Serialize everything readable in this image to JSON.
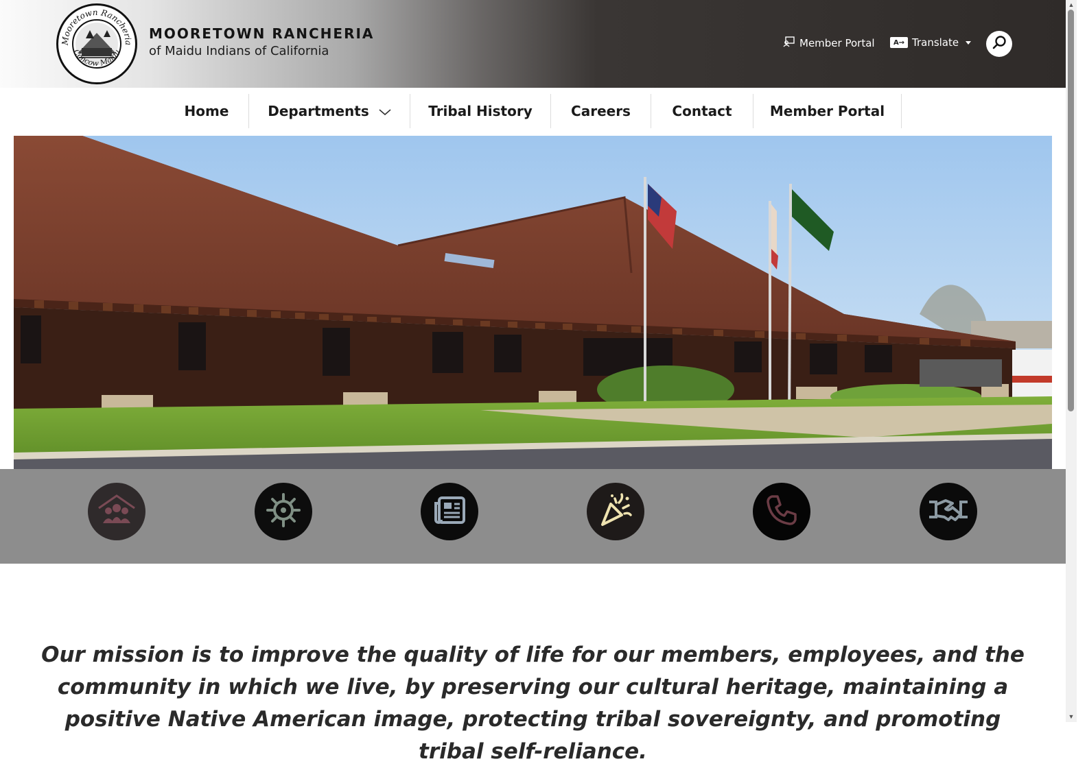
{
  "header": {
    "brand_name": "MOORETOWN RANCHERIA",
    "brand_subtitle": "of Maidu Indians of California",
    "logo_ring_top": "Mooretown Rancheria",
    "logo_ring_bottom": "Concow Maidu",
    "member_portal_label": "Member Portal",
    "translate_label": "Translate",
    "translate_icon_text": "A→",
    "colors": {
      "header_dark": "#2f2b29",
      "header_light": "#fbfbfb"
    }
  },
  "nav": {
    "items": [
      {
        "label": "Home"
      },
      {
        "label": "Departments"
      },
      {
        "label": "Tribal History"
      },
      {
        "label": "Careers"
      },
      {
        "label": "Contact"
      },
      {
        "label": "Member Portal"
      }
    ]
  },
  "hero": {
    "alt": "Tribal administration building with flags"
  },
  "quick_links": [
    {
      "icon": "community-house-icon",
      "bg": "#2f2a2b",
      "fg": "#7a4a55"
    },
    {
      "icon": "virus-icon",
      "bg": "#0d0d0d",
      "fg": "#7f8f84"
    },
    {
      "icon": "newspaper-icon",
      "bg": "#0b0b0b",
      "fg": "#9aa9b8"
    },
    {
      "icon": "party-popper-icon",
      "bg": "#1e1a19",
      "fg": "#efe3b0"
    },
    {
      "icon": "phone-icon",
      "bg": "#050505",
      "fg": "#6b3c45"
    },
    {
      "icon": "handshake-icon",
      "bg": "#0b0b0b",
      "fg": "#8c9aa3"
    }
  ],
  "mission": {
    "text": "Our mission is to improve the quality of life for our members, employees, and the community in which we live, by preserving our cultural heritage, maintaining a positive Native American image, protecting tribal sovereignty, and promoting tribal self-reliance."
  }
}
